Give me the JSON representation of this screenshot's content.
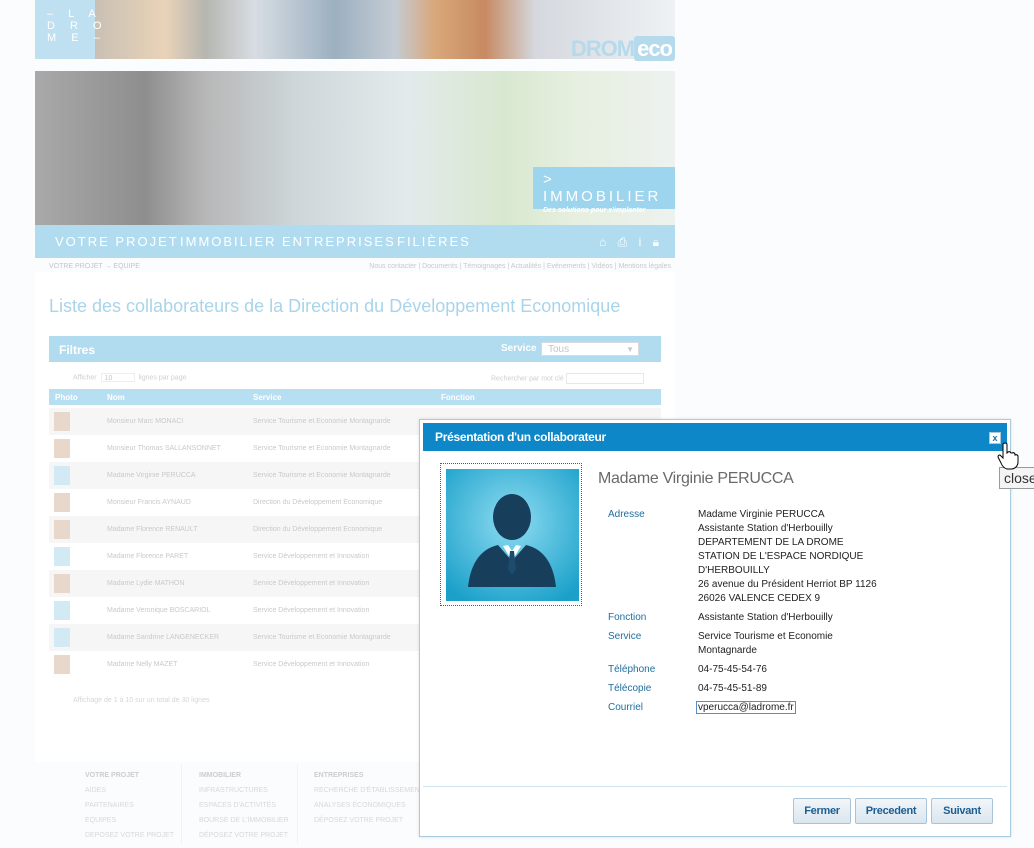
{
  "header": {
    "logo_text": "– L A\nD R O\nM E –",
    "brand_left": "DROM",
    "brand_right": "eco"
  },
  "hero": {
    "caption_title": "> IMMOBILIER",
    "caption_subtitle": "Des solutions pour s'implanter"
  },
  "nav": {
    "items": [
      "VOTRE PROJET",
      "IMMOBILIER",
      "ENTREPRISES",
      "FILIÈRES"
    ],
    "icons": [
      "home-icon",
      "print-icon",
      "info-icon",
      "lock-icon"
    ]
  },
  "breadcrumb": "VOTRE PROJET  →  EQUIPE",
  "top_links": "Nous contacter | Documents | Témoignages | Actualités | Evénements | Vidéos | Mentions légales",
  "page_title": "Liste des collaborateurs de la Direction du Développement Economique",
  "filters": {
    "title": "Filtres",
    "service_label": "Service",
    "service_value": "Tous"
  },
  "table": {
    "show_prefix": "Afficher",
    "page_length": "10",
    "show_suffix": "lignes par page",
    "search_label": "Rechercher par mot clé",
    "columns": [
      "Photo",
      "Nom",
      "Service",
      "Fonction"
    ],
    "rows": [
      {
        "name": "Monsieur Marc MONACI",
        "service": "Service Tourisme et Economie Montagnarde"
      },
      {
        "name": "Monsieur Thomas SALLANSONNET",
        "service": "Service Tourisme et Economie Montagnarde"
      },
      {
        "name": "Madame Virginie PERUCCA",
        "service": "Service Tourisme et Economie Montagnarde"
      },
      {
        "name": "Monsieur Francis AYNAUD",
        "service": "Direction du Développement Economique"
      },
      {
        "name": "Madame Florence RENAULT",
        "service": "Direction du Développement Economique"
      },
      {
        "name": "Madame Florence PARET",
        "service": "Service Développement et Innovation"
      },
      {
        "name": "Madame Lydie MATHON",
        "service": "Service Développement et Innovation"
      },
      {
        "name": "Madame Veronique BOSCARIOL",
        "service": "Service Développement et Innovation"
      },
      {
        "name": "Madame Sandrine LANGENECKER",
        "service": "Service Tourisme et Economie Montagnarde"
      },
      {
        "name": "Madame Nelly MAZET",
        "service": "Service Développement et Innovation"
      }
    ],
    "info": "Affichage de 1 à 10 sur un total de 30 lignes"
  },
  "footer": {
    "col1_title": "VOTRE PROJET",
    "col1_items": [
      "AIDES",
      "PARTENAIRES",
      "EQUIPES",
      "DEPOSEZ VOTRE PROJET"
    ],
    "col2_title": "IMMOBILIER",
    "col2_items": [
      "INFRASTRUCTURES",
      "ESPACES D'ACTIVITÉS",
      "BOURSE DE L'IMMOBILIER",
      "DÉPOSEZ VOTRE PROJET"
    ],
    "col3_title": "ENTREPRISES",
    "col3_items": [
      "RECHERCHE D'ÉTABLISSEMENTS",
      "ANALYSES ÉCONOMIQUES",
      "DÉPOSEZ VOTRE PROJET"
    ]
  },
  "modal": {
    "title": "Présentation d'un collaborateur",
    "close_symbol": "x",
    "name": "Madame Virginie PERUCCA",
    "fields": {
      "adresse_label": "Adresse",
      "adresse_value": "Madame Virginie PERUCCA\nAssistante Station d'Herbouilly\nDEPARTEMENT DE LA DROME\nSTATION DE L'ESPACE NORDIQUE\nD'HERBOUILLY\n26 avenue du Président Herriot BP 1126\n26026 VALENCE CEDEX 9",
      "fonction_label": "Fonction",
      "fonction_value": "Assistante Station d'Herbouilly",
      "service_label": "Service",
      "service_value": "Service Tourisme et Economie\nMontagnarde",
      "telephone_label": "Téléphone",
      "telephone_value": "04-75-45-54-76",
      "telecopie_label": "Télécopie",
      "telecopie_value": "04-75-45-51-89",
      "courriel_label": "Courriel",
      "courriel_value": "vperucca@ladrome.fr"
    },
    "buttons": {
      "close": "Fermer",
      "prev": "Precedent",
      "next": "Suivant"
    },
    "tooltip": "close"
  }
}
